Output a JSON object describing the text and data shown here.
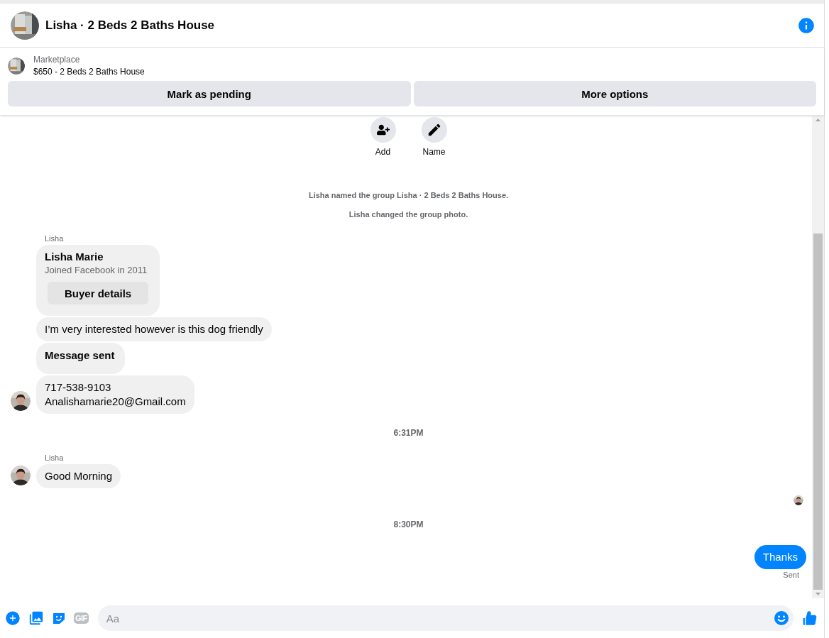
{
  "header": {
    "title": "Lisha · 2 Beds 2 Baths House"
  },
  "listing": {
    "source": "Marketplace",
    "title": "$650 - 2 Beds 2 Baths House",
    "buttons": [
      "Mark as pending",
      "More options"
    ]
  },
  "group_actions": [
    "Add",
    "Name"
  ],
  "timeline": [
    {
      "kind": "event",
      "text": "Lisha named the group Lisha · 2 Beds 2 Baths House."
    },
    {
      "kind": "event",
      "text": "Lisha changed the group photo."
    },
    {
      "kind": "incoming",
      "sender": "Lisha",
      "messages": [
        {
          "kind": "card",
          "name": "Lisha Marie",
          "subtitle": "Joined Facebook in 2011",
          "button": "Buyer details"
        },
        {
          "kind": "text",
          "lines": [
            "I’m very interested however is this dog friendly"
          ]
        },
        {
          "kind": "notice",
          "lines": [
            "Message sent"
          ]
        },
        {
          "kind": "text",
          "lines": [
            "717-538-9103",
            "Analishamarie20@Gmail.com"
          ]
        }
      ]
    },
    {
      "kind": "time",
      "text": "6:31PM"
    },
    {
      "kind": "incoming",
      "sender": "Lisha",
      "messages": [
        {
          "kind": "text",
          "lines": [
            "Good Morning"
          ]
        }
      ]
    },
    {
      "kind": "seen"
    },
    {
      "kind": "time",
      "text": "8:30PM"
    },
    {
      "kind": "outgoing",
      "text": "Thanks",
      "status": "Sent"
    }
  ],
  "composer": {
    "gif_label": "GIF",
    "placeholder": "Aa"
  }
}
